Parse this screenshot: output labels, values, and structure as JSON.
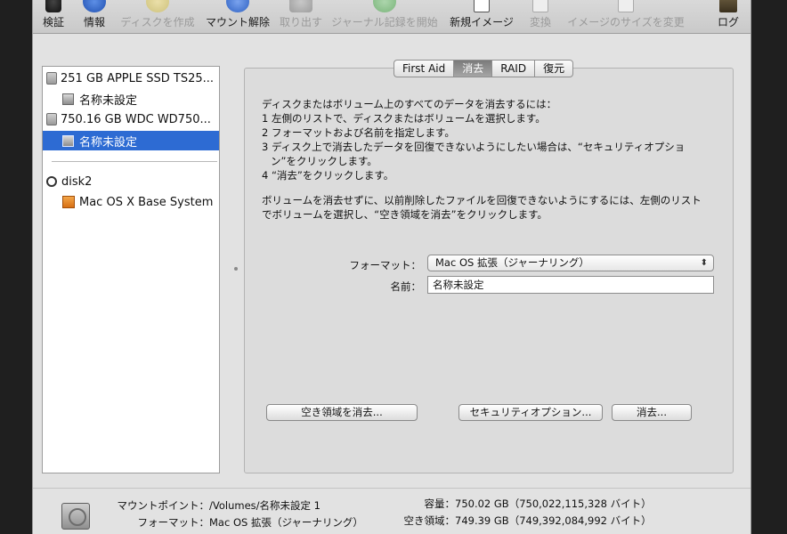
{
  "toolbar": {
    "items": [
      {
        "label": "検証",
        "icon": "microscope-icon",
        "enabled": true
      },
      {
        "label": "情報",
        "icon": "info-icon",
        "enabled": true
      },
      {
        "label": "ディスクを作成",
        "icon": "burn-icon",
        "enabled": false
      },
      {
        "label": "マウント解除",
        "icon": "unmount-icon",
        "enabled": true
      },
      {
        "label": "取り出す",
        "icon": "eject-icon",
        "enabled": false
      },
      {
        "label": "ジャーナル記録を開始",
        "icon": "journal-icon",
        "enabled": false
      },
      {
        "label": "新規イメージ",
        "icon": "new-image-icon",
        "enabled": true
      },
      {
        "label": "変換",
        "icon": "convert-icon",
        "enabled": false
      },
      {
        "label": "イメージのサイズを変更",
        "icon": "resize-icon",
        "enabled": false
      },
      {
        "label": "ログ",
        "icon": "log-icon",
        "enabled": true
      }
    ]
  },
  "sidebar": {
    "items": [
      {
        "label": "251 GB APPLE SSD TS25...",
        "type": "disk"
      },
      {
        "label": "名称未設定",
        "type": "volume"
      },
      {
        "label": "750.16 GB WDC WD750...",
        "type": "disk"
      },
      {
        "label": "名称未設定",
        "type": "volume",
        "selected": true
      },
      {
        "label": "disk2",
        "type": "disk-image"
      },
      {
        "label": "Mac OS X Base System",
        "type": "installer-volume"
      }
    ]
  },
  "tabs": [
    {
      "label": "First Aid"
    },
    {
      "label": "消去",
      "active": true
    },
    {
      "label": "RAID"
    },
    {
      "label": "復元"
    }
  ],
  "erase": {
    "instructions": [
      "ディスクまたはボリューム上のすべてのデータを消去するには：",
      "1 左側のリストで、ディスクまたはボリュームを選択します。",
      "2 フォーマットおよび名前を指定します。",
      "3 ディスク上で消去したデータを回復できないようにしたい場合は、“セキュリティオプショ",
      "ン”をクリックします。",
      "4 “消去”をクリックします。"
    ],
    "note": [
      "ボリュームを消去せずに、以前削除したファイルを回復できないようにするには、左側のリスト",
      "でボリュームを選択し、“空き領域を消去”をクリックします。"
    ],
    "format_label": "フォーマット：",
    "format_value": "Mac OS 拡張（ジャーナリング）",
    "name_label": "名前：",
    "name_value": "名称未設定",
    "erase_free_space_button": "空き領域を消去...",
    "security_options_button": "セキュリティオプション...",
    "erase_button": "消去..."
  },
  "info": {
    "mount_point_label": "マウントポイント：",
    "mount_point_value": "/Volumes/名称未設定 1",
    "format_label": "フォーマット：",
    "format_value": "Mac OS 拡張（ジャーナリング）",
    "capacity_label": "容量：",
    "capacity_value": "750.02 GB（750,022,115,328 バイト）",
    "free_label": "空き領域：",
    "free_value": "749.39 GB（749,392,084,992 バイト）"
  }
}
